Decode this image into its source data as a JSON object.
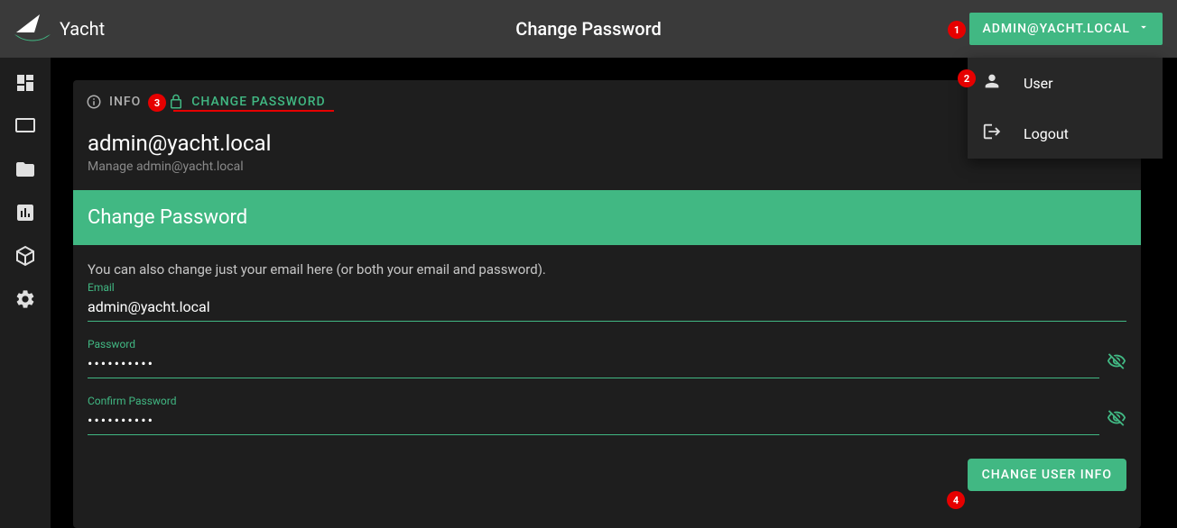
{
  "app": {
    "name": "Yacht",
    "page_title": "Change Password"
  },
  "user_chip": {
    "label": "ADMIN@YACHT.LOCAL"
  },
  "dropdown": {
    "user": "User",
    "logout": "Logout"
  },
  "tabs": {
    "info": "INFO",
    "change_password": "CHANGE PASSWORD"
  },
  "card": {
    "title": "admin@yacht.local",
    "subtitle": "Manage admin@yacht.local"
  },
  "section": {
    "title": "Change Password",
    "description": "You can also change just your email here (or both your email and password).",
    "email_label": "Email",
    "email_value": "admin@yacht.local",
    "password_label": "Password",
    "password_value": "••••••••••",
    "confirm_label": "Confirm Password",
    "confirm_value": "••••••••••"
  },
  "actions": {
    "submit": "CHANGE USER INFO"
  },
  "annotations": {
    "1": "1",
    "2": "2",
    "3": "3",
    "4": "4"
  },
  "colors": {
    "primary": "#41b883",
    "annotation": "#e60000"
  }
}
